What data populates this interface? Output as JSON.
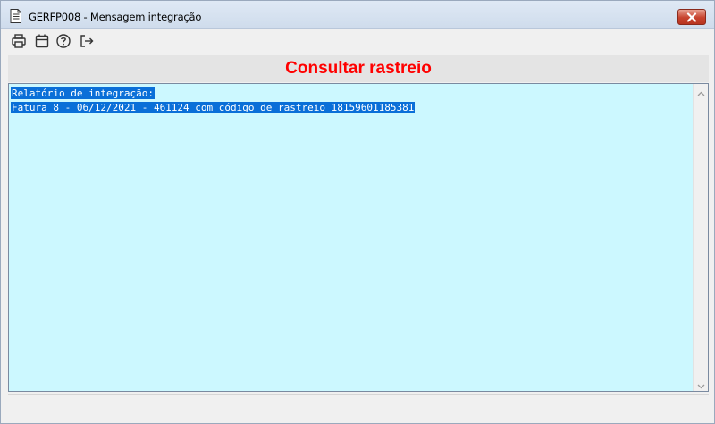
{
  "window": {
    "title": "GERFP008 - Mensagem integração",
    "icons": {
      "app": "document-icon",
      "close": "close-icon"
    }
  },
  "toolbar": {
    "items": [
      {
        "icon": "printer-icon",
        "tooltip": ""
      },
      {
        "icon": "calendar-icon",
        "tooltip": ""
      },
      {
        "icon": "help-icon",
        "tooltip": ""
      },
      {
        "icon": "exit-icon",
        "tooltip": ""
      }
    ]
  },
  "heading": {
    "title": "Consultar rastreio",
    "color": "#ff0000"
  },
  "content": {
    "lines": [
      "Relatório de integração:",
      "Fatura 8 - 06/12/2021 - 461124 com código de rastreio 18159601185381"
    ],
    "background": "#ccf8ff",
    "selection_color": "#0a6fd8"
  }
}
